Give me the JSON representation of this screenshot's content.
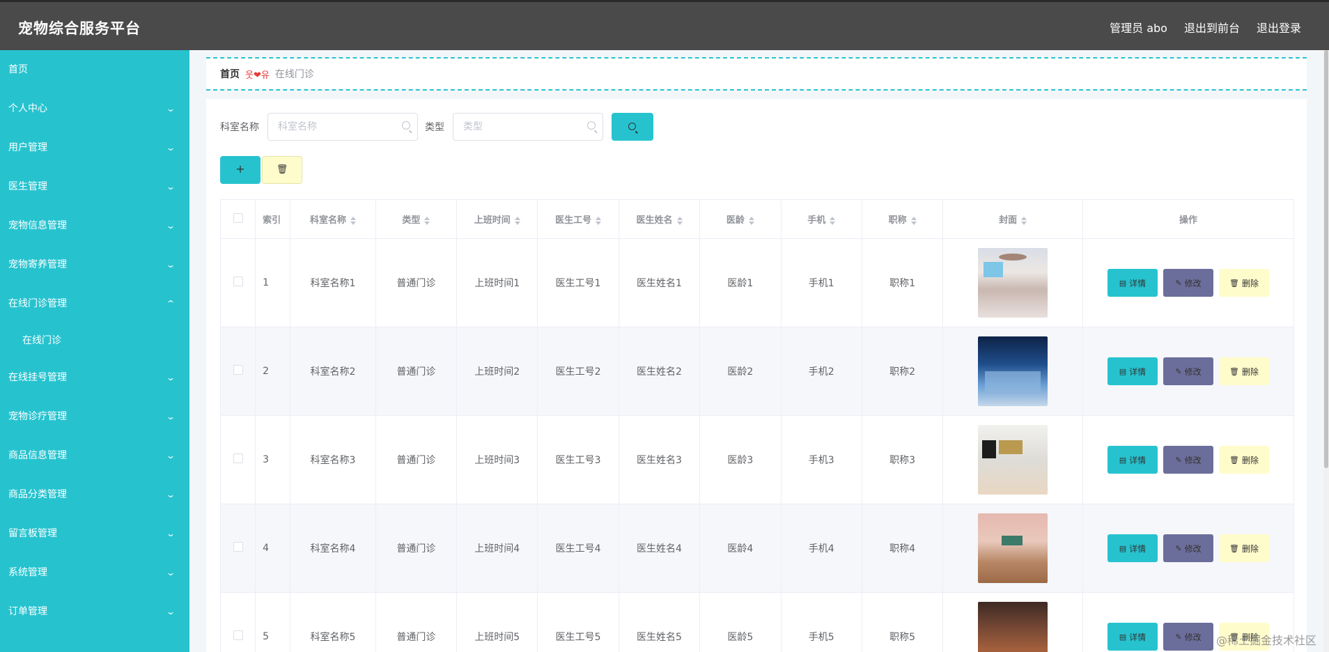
{
  "header": {
    "title": "宠物综合服务平台",
    "user": "管理员 abo",
    "to_front": "退出到前台",
    "logout": "退出登录"
  },
  "sidebar": {
    "items": [
      {
        "label": "首页"
      },
      {
        "label": "个人中心"
      },
      {
        "label": "用户管理"
      },
      {
        "label": "医生管理"
      },
      {
        "label": "宠物信息管理"
      },
      {
        "label": "宠物寄养管理"
      },
      {
        "label": "在线门诊管理"
      },
      {
        "label": "在线门诊"
      },
      {
        "label": "在线挂号管理"
      },
      {
        "label": "宠物诊疗管理"
      },
      {
        "label": "商品信息管理"
      },
      {
        "label": "商品分类管理"
      },
      {
        "label": "留言板管理"
      },
      {
        "label": "系统管理"
      },
      {
        "label": "订单管理"
      }
    ]
  },
  "breadcrumb": {
    "home": "首页",
    "separator": "웃❤유",
    "current": "在线门诊"
  },
  "search": {
    "dept_label": "科室名称",
    "dept_placeholder": "科室名称",
    "type_label": "类型",
    "type_placeholder": "类型"
  },
  "actions": {
    "add_label": "+",
    "delete_icon": "trash-icon"
  },
  "table": {
    "headers": {
      "index": "索引",
      "dept": "科室名称",
      "type": "类型",
      "time": "上班时间",
      "doctor_id": "医生工号",
      "doctor_name": "医生姓名",
      "age": "医龄",
      "phone": "手机",
      "title": "职称",
      "cover": "封面",
      "ops": "操作"
    },
    "rows": [
      {
        "index": "1",
        "dept": "科室名称1",
        "type": "普通门诊",
        "time": "上班时间1",
        "doctor_id": "医生工号1",
        "doctor_name": "医生姓名1",
        "age": "医龄1",
        "phone": "手机1",
        "title": "职称1"
      },
      {
        "index": "2",
        "dept": "科室名称2",
        "type": "普通门诊",
        "time": "上班时间2",
        "doctor_id": "医生工号2",
        "doctor_name": "医生姓名2",
        "age": "医龄2",
        "phone": "手机2",
        "title": "职称2"
      },
      {
        "index": "3",
        "dept": "科室名称3",
        "type": "普通门诊",
        "time": "上班时间3",
        "doctor_id": "医生工号3",
        "doctor_name": "医生姓名3",
        "age": "医龄3",
        "phone": "手机3",
        "title": "职称3"
      },
      {
        "index": "4",
        "dept": "科室名称4",
        "type": "普通门诊",
        "time": "上班时间4",
        "doctor_id": "医生工号4",
        "doctor_name": "医生姓名4",
        "age": "医龄4",
        "phone": "手机4",
        "title": "职称4"
      },
      {
        "index": "5",
        "dept": "科室名称5",
        "type": "普通门诊",
        "time": "上班时间5",
        "doctor_id": "医生工号5",
        "doctor_name": "医生姓名5",
        "age": "医龄5",
        "phone": "手机5",
        "title": "职称5"
      }
    ],
    "op_labels": {
      "detail": "详情",
      "edit": "修改",
      "delete": "删除"
    }
  },
  "watermark": "@稀土掘金技术社区",
  "colors": {
    "header": "#4a4a4a",
    "accent": "#26c3cf",
    "edit": "#6b6e9a",
    "delete": "#fffccc"
  }
}
